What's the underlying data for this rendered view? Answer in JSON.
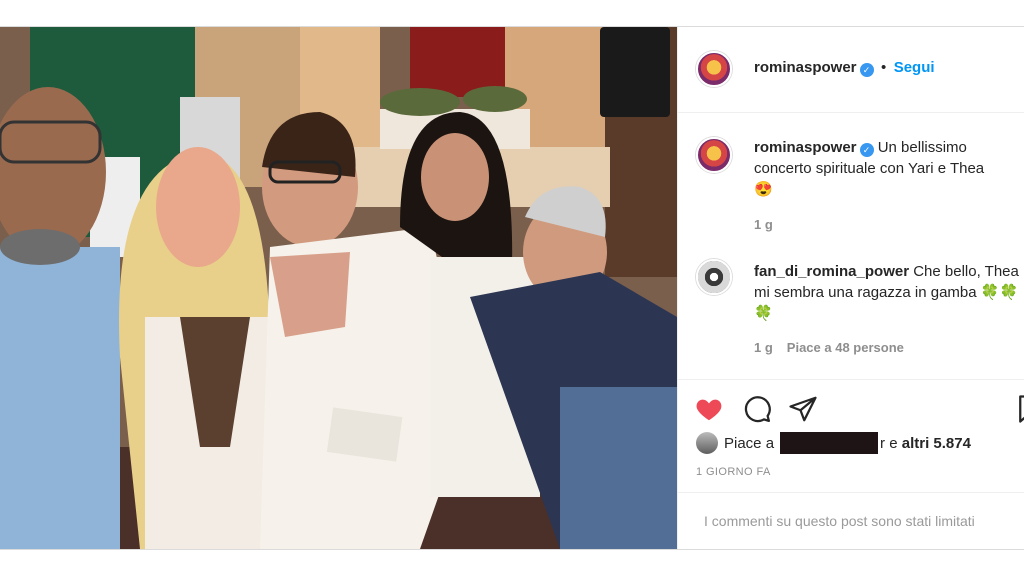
{
  "post": {
    "author": {
      "username": "rominaspower",
      "verified": true
    },
    "follow_label": "Segui",
    "separator": "•",
    "caption": {
      "username": "rominaspower",
      "text": "Un bellissimo concerto spirituale con Yari e Thea",
      "emoji": "😍",
      "time": "1 g"
    },
    "comments": [
      {
        "username": "fan_di_romina_power",
        "text": "Che bello, Thea mi sembra una ragazza in gamba 🍀🍀🍀",
        "time": "1 g",
        "likes": "Piace a 48 persone"
      }
    ],
    "likes": {
      "prefix": "Piace a",
      "middle": "r e",
      "others": "altri 5.874"
    },
    "date": "1 GIORNO FA",
    "comments_closed": "I commenti su questo post sono stati limitati"
  },
  "colors": {
    "accent": "#0095f6",
    "heart": "#ed4956",
    "verified": "#3897f0"
  },
  "icons": [
    "heart-icon",
    "comment-icon",
    "share-icon",
    "bookmark-icon",
    "verified-badge-icon"
  ]
}
